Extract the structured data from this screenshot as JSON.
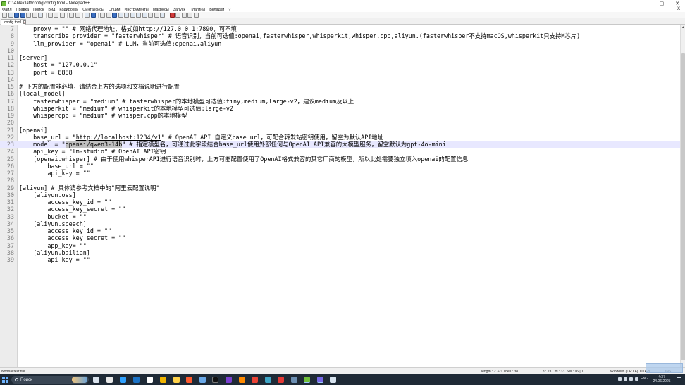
{
  "window": {
    "title": "C:\\AI\\lexilaff\\config\\config.toml - Notepad++",
    "controls": [
      "–",
      "▢",
      "✕"
    ]
  },
  "menu": [
    "Файл",
    "Правка",
    "Поиск",
    "Вид",
    "Кодировки",
    "Синтаксисы",
    "Опции",
    "Инструменты",
    "Макросы",
    "Запуск",
    "Плагины",
    "Вкладки",
    "?"
  ],
  "menu_close": "X",
  "tab": {
    "label": "config.toml",
    "close": "x"
  },
  "editor": {
    "current_line": 23,
    "lines": [
      {
        "n": "7",
        "text": "    proxy = \"\" # 网络代理地址，格式如http://127.0.0.1:7890，可不填"
      },
      {
        "n": "8",
        "text": "    transcribe_provider = \"fasterwhisper\" # 语音识别，当前可选值:openai,fasterwhisper,whisperkit,whisper.cpp,aliyun.(fasterwhisper不支持macOS,whisperkit只支持M芯片)"
      },
      {
        "n": "9",
        "text": "    llm_provider = \"openai\" # LLM，当前可选值:openai,aliyun"
      },
      {
        "n": "10",
        "text": ""
      },
      {
        "n": "11",
        "text": "[server]"
      },
      {
        "n": "12",
        "text": "    host = \"127.0.0.1\""
      },
      {
        "n": "13",
        "text": "    port = 8888"
      },
      {
        "n": "14",
        "text": ""
      },
      {
        "n": "15",
        "text": "# 下方的配置非必填，请结合上方的选项和文档说明进行配置"
      },
      {
        "n": "16",
        "text": "[local_model]"
      },
      {
        "n": "17",
        "text": "    fasterwhisper = \"medium\" # fasterwhisper的本地模型可选值:tiny,medium,large-v2，建议medium及以上"
      },
      {
        "n": "18",
        "text": "    whisperkit = \"medium\" # whisperkit的本地模型可选值:large-v2"
      },
      {
        "n": "19",
        "text": "    whispercpp = \"medium\" # whisper.cpp的本地模型"
      },
      {
        "n": "20",
        "text": ""
      },
      {
        "n": "21",
        "text": "[openai]"
      },
      {
        "n": "22",
        "pre": "    base_url = \"",
        "link": "http://localhost:1234/v1",
        "post": "\" # OpenAI API 自定义base url，可配合转发站密钥使用，留空为默认API地址"
      },
      {
        "n": "23",
        "pre": "    model = \"",
        "selected": "openai/qwen3-14b",
        "post": "\" # 指定模型名，可通过此字段结合base_url使用外部任何与OpenAI API兼容的大模型服务，留空默认为gpt-4o-mini"
      },
      {
        "n": "24",
        "text": "    api_key = \"lm-studio\" # OpenAI API密钥"
      },
      {
        "n": "25",
        "text": "    [openai.whisper] # 由于使用whisperAPI进行语音识别时，上方可能配置使用了OpenAI格式兼容的其它厂商的模型，所以此处需要独立填入openai的配置信息"
      },
      {
        "n": "26",
        "text": "        base_url = \"\""
      },
      {
        "n": "27",
        "text": "        api_key = \"\""
      },
      {
        "n": "28",
        "text": ""
      },
      {
        "n": "29",
        "text": "[aliyun] # 具体请参考文档中的\"阿里云配置说明\""
      },
      {
        "n": "30",
        "text": "    [aliyun.oss]"
      },
      {
        "n": "31",
        "text": "        access_key_id = \"\""
      },
      {
        "n": "32",
        "text": "        access_key_secret = \"\""
      },
      {
        "n": "33",
        "text": "        bucket = \"\""
      },
      {
        "n": "34",
        "text": "    [aliyun.speech]"
      },
      {
        "n": "35",
        "text": "        access_key_id = \"\""
      },
      {
        "n": "36",
        "text": "        access_key_secret = \"\""
      },
      {
        "n": "37",
        "text": "        app_key= \"\""
      },
      {
        "n": "38",
        "text": "    [aliyun.bailian]"
      },
      {
        "n": "39",
        "text": "        api_key = \"\""
      }
    ]
  },
  "status": {
    "type": "Normal text file",
    "length": "length : 2 321",
    "lines": "lines : 38",
    "pos": "Ln : 23",
    "col": "Col : 33",
    "sel": "Sel : 16 | 1",
    "eol": "Windows (CR LF)",
    "enc": "UTF-8",
    "mode": "INS"
  },
  "taskbar": {
    "search_placeholder": "Поиск",
    "lang": "ENG",
    "time": "4:37",
    "date": "24.06.2025"
  },
  "colors": {
    "current_line_bg": "#e8e8ff",
    "selection_bg": "#c0c0c0",
    "taskbar_bg": "#1f2a36"
  }
}
